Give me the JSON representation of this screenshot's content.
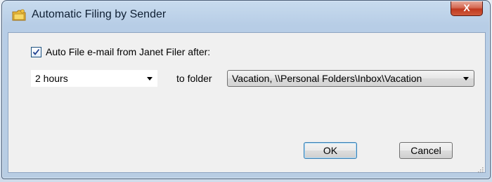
{
  "window": {
    "title": "Automatic Filing by Sender",
    "close_label": "X"
  },
  "auto_file": {
    "checked": true,
    "label": "Auto File e-mail from Janet Filer after:"
  },
  "hours_select": {
    "value": "2 hours"
  },
  "folder": {
    "label": "to folder",
    "value": "Vacation, \\\\Personal Folders\\Inbox\\Vacation"
  },
  "buttons": {
    "ok": "OK",
    "cancel": "Cancel"
  },
  "icons": {
    "app": "folder-icon",
    "checkbox": "checkmark-icon",
    "dropdown": "chevron-down-icon",
    "resize": "resize-grip-icon"
  },
  "colors": {
    "titlebar": "#c8dbee",
    "close_button": "#c0391f",
    "dialog_background": "#f0f0f0",
    "default_button_border": "#3c7fb1"
  }
}
